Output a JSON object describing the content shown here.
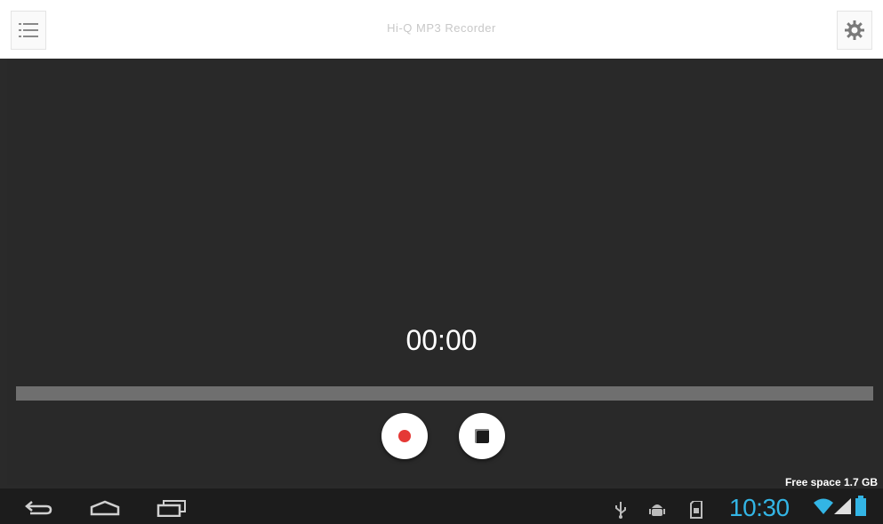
{
  "app": {
    "title": "Hi-Q MP3 Recorder"
  },
  "recorder": {
    "timer": "00:00",
    "progress_percent": 0
  },
  "footer": {
    "free_space": "Free space 1.7 GB"
  },
  "system": {
    "clock": "10:30"
  },
  "icons": {
    "menu": "menu-list-icon",
    "settings": "gear-icon",
    "record": "record-dot-icon",
    "stop": "stop-square-icon",
    "back": "back-icon",
    "home": "home-icon",
    "recents": "recent-apps-icon",
    "usb": "usb-icon",
    "debug": "android-debug-icon",
    "sdcard": "sd-card-icon",
    "wifi": "wifi-icon",
    "signal": "signal-icon",
    "battery": "battery-icon"
  },
  "colors": {
    "background": "#292929",
    "record": "#e53935",
    "clock": "#33b5e5",
    "progress_track": "#6f6f6f"
  }
}
